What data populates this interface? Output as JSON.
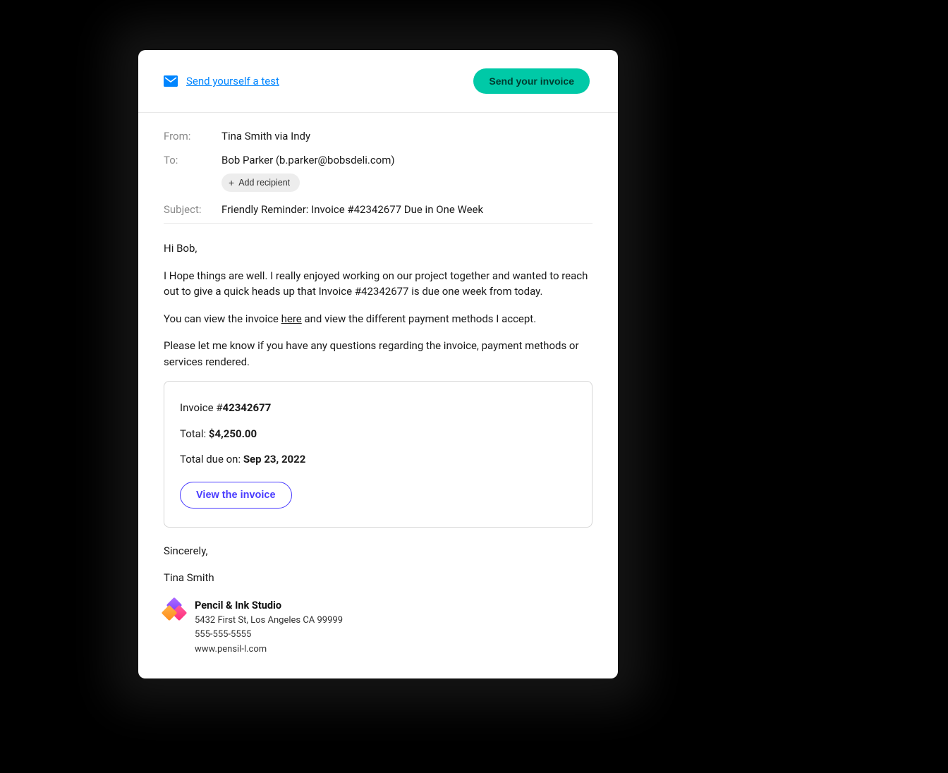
{
  "header": {
    "test_link_label": "Send yourself a test",
    "send_button_label": "Send your invoice"
  },
  "fields": {
    "from_label": "From:",
    "from_value": "Tina Smith via Indy",
    "to_label": "To:",
    "to_value": "Bob Parker (b.parker@bobsdeli.com)",
    "add_recipient_label": "Add recipient",
    "subject_label": "Subject:",
    "subject_value": "Friendly Reminder: Invoice #42342677 Due in One Week"
  },
  "body": {
    "greeting": "Hi Bob,",
    "p1": "I Hope things are well. I really enjoyed working on our project together and wanted to reach out to give a quick heads up that Invoice #42342677 is due one week from today.",
    "p2_pre": "You can view the invoice ",
    "p2_link": "here",
    "p2_post": " and view the different payment methods I accept.",
    "p3": "Please let me know if you have any questions regarding the invoice, payment methods or services rendered."
  },
  "invoice": {
    "prefix": "Invoice #",
    "number": "42342677",
    "total_label": "Total: ",
    "total_value": "$4,250.00",
    "due_label": "Total due on: ",
    "due_value": "Sep 23, 2022",
    "view_button": "View the invoice"
  },
  "signature": {
    "signoff": "Sincerely,",
    "name": "Tina Smith",
    "company_name": "Pencil & Ink Studio",
    "address": "5432 First St, Los Angeles CA 99999",
    "phone": "555-555-5555",
    "website": "www.pensil-l.com"
  }
}
